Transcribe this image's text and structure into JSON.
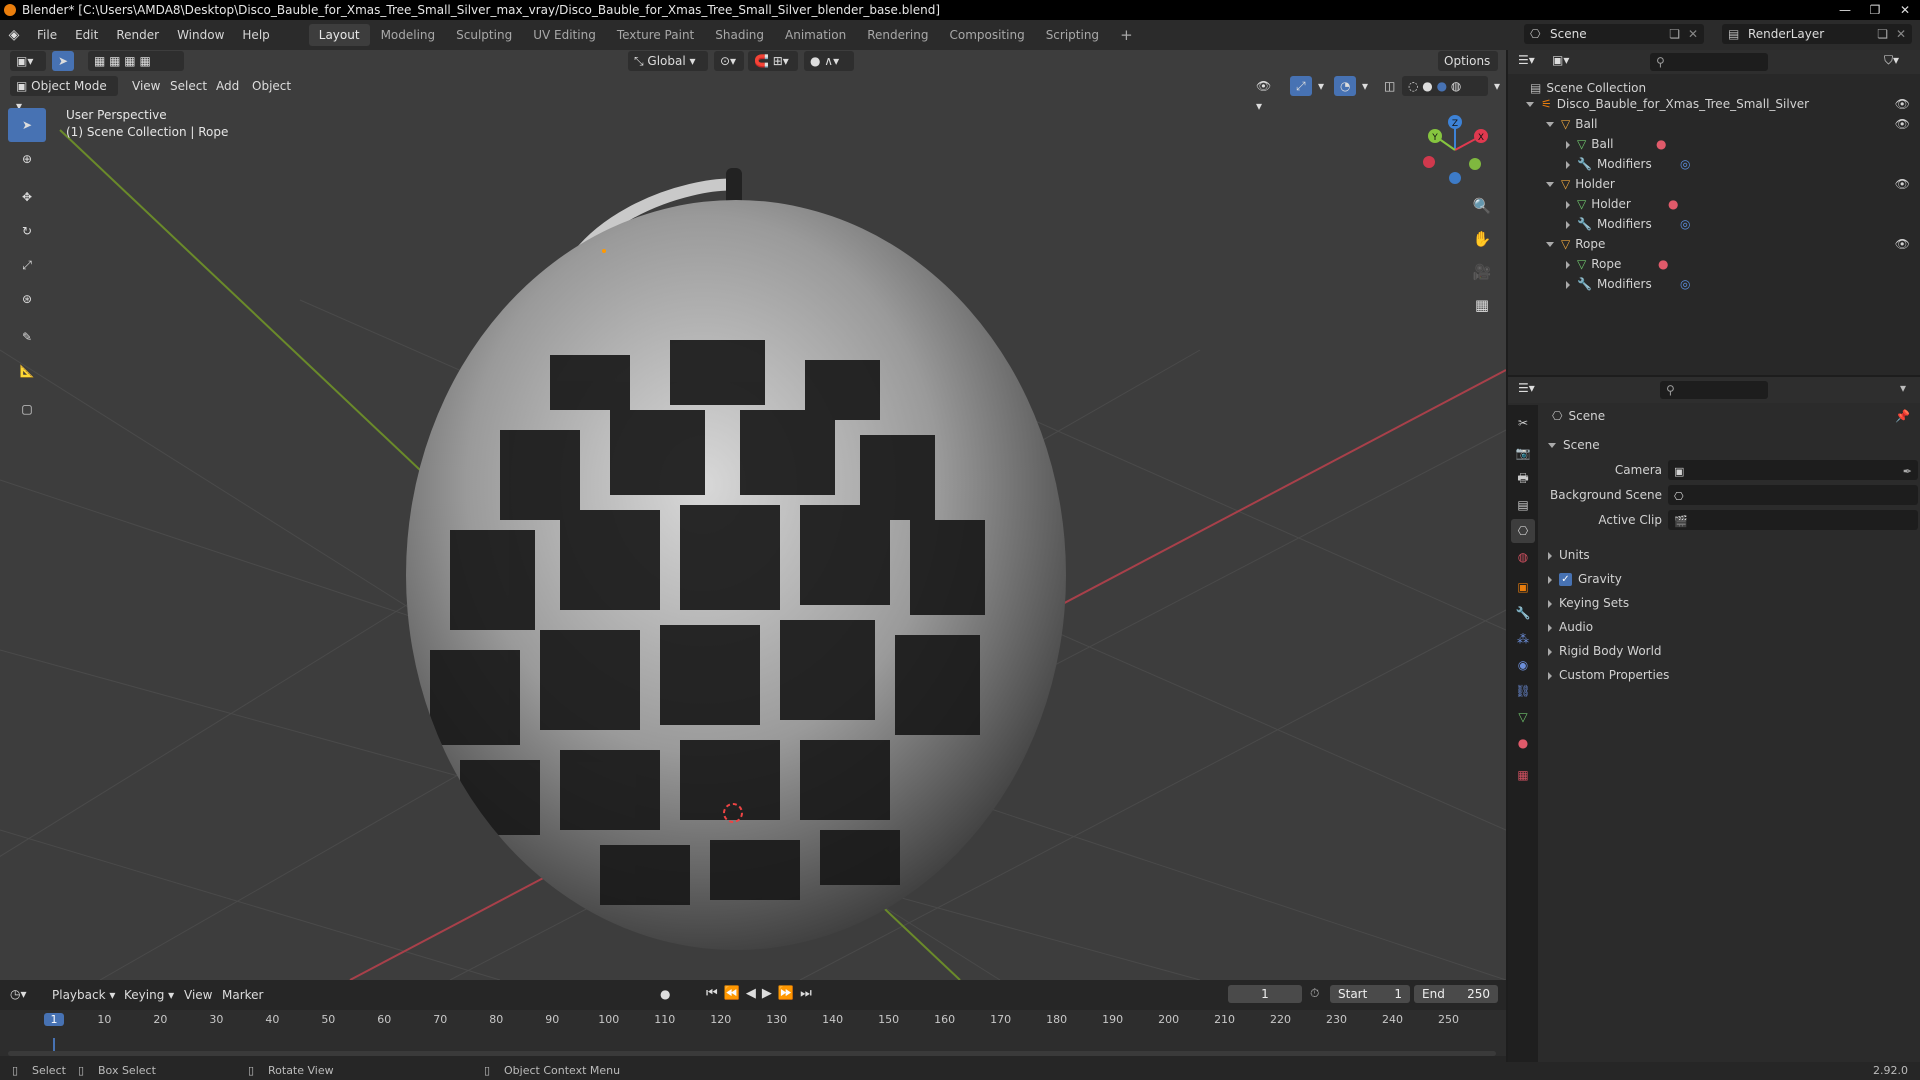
{
  "window": {
    "title": "Blender* [C:\\Users\\AMDA8\\Desktop\\Disco_Bauble_for_Xmas_Tree_Small_Silver_max_vray/Disco_Bauble_for_Xmas_Tree_Small_Silver_blender_base.blend]",
    "controls": [
      "—",
      "❐",
      "✕"
    ]
  },
  "menubar": {
    "menus": [
      "File",
      "Edit",
      "Render",
      "Window",
      "Help"
    ],
    "workspaces": [
      "Layout",
      "Modeling",
      "Sculpting",
      "UV Editing",
      "Texture Paint",
      "Shading",
      "Animation",
      "Rendering",
      "Compositing",
      "Scripting"
    ],
    "active_workspace": "Layout",
    "add_tab": "+",
    "scene": "Scene",
    "view_layer": "RenderLayer"
  },
  "viewport": {
    "mode": "Object Mode",
    "menus": [
      "View",
      "Select",
      "Add",
      "Object"
    ],
    "transform_orientation": "Global",
    "options_label": "Options",
    "overlay_line1": "User Perspective",
    "overlay_line2": "(1) Scene Collection | Rope",
    "gizmo": {
      "x": "X",
      "y": "Y",
      "z": "Z"
    }
  },
  "timeline": {
    "menus": [
      "Playback",
      "Keying",
      "View",
      "Marker"
    ],
    "current_frame": "1",
    "start_label": "Start",
    "start_value": "1",
    "end_label": "End",
    "end_value": "250",
    "ruler": [
      "1",
      "10",
      "20",
      "30",
      "40",
      "50",
      "60",
      "70",
      "80",
      "90",
      "100",
      "110",
      "120",
      "130",
      "140",
      "150",
      "160",
      "170",
      "180",
      "190",
      "200",
      "210",
      "220",
      "230",
      "240",
      "250"
    ]
  },
  "outliner": {
    "root": "Scene Collection",
    "collection": "Disco_Bauble_for_Xmas_Tree_Small_Silver",
    "objects": [
      {
        "name": "Ball",
        "mesh": "Ball",
        "modifiers": "Modifiers"
      },
      {
        "name": "Holder",
        "mesh": "Holder",
        "modifiers": "Modifiers"
      },
      {
        "name": "Rope",
        "mesh": "Rope",
        "modifiers": "Modifiers"
      }
    ]
  },
  "properties": {
    "context": "Scene",
    "panel": "Scene",
    "camera_label": "Camera",
    "background_scene_label": "Background Scene",
    "active_clip_label": "Active Clip",
    "sections": [
      "Units",
      "Gravity",
      "Keying Sets",
      "Audio",
      "Rigid Body World",
      "Custom Properties"
    ],
    "gravity_checked": true
  },
  "statusbar": {
    "select": "Select",
    "box_select": "Box Select",
    "rotate_view": "Rotate View",
    "context_menu": "Object Context Menu",
    "version": "2.92.0"
  },
  "colors": {
    "accent": "#4772b3",
    "x_axis": "#e0394f",
    "y_axis": "#86c53f",
    "z_axis": "#3d82d6",
    "brand": "#e87d0d"
  }
}
